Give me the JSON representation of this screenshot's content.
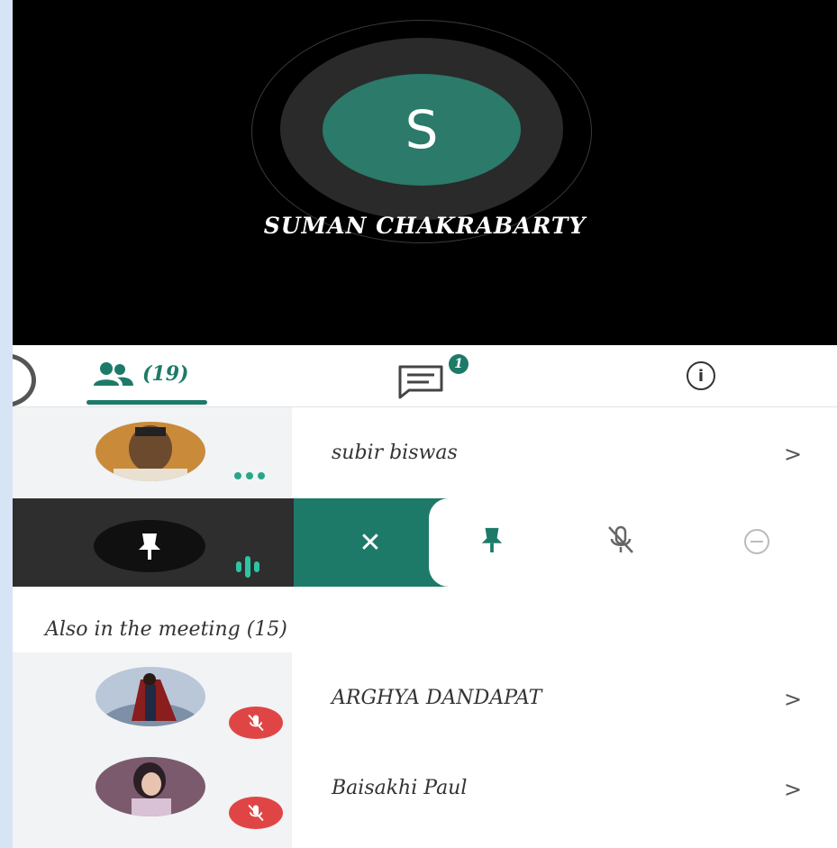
{
  "speaker": {
    "initial": "S",
    "name": "SUMAN CHAKRABARTY",
    "avatar_color": "#2b7a6a"
  },
  "tabs": {
    "people_count": "(19)",
    "chat_badge": "1",
    "info_symbol": "i",
    "accent_color": "#1e7a68"
  },
  "pinned_participant": {
    "name": "subir biswas",
    "chevron": ">"
  },
  "actions": {
    "close_symbol": "✕",
    "items": [
      "pin-icon",
      "mute-mic-icon",
      "remove-icon"
    ]
  },
  "also_in_meeting": {
    "title": "Also in the meeting (15)",
    "participants": [
      {
        "name": "ARGHYA DANDAPAT",
        "chevron": ">",
        "muted": true
      },
      {
        "name": "Baisakhi Paul",
        "chevron": ">",
        "muted": true
      }
    ]
  },
  "mute_badge_color": "#e04545"
}
